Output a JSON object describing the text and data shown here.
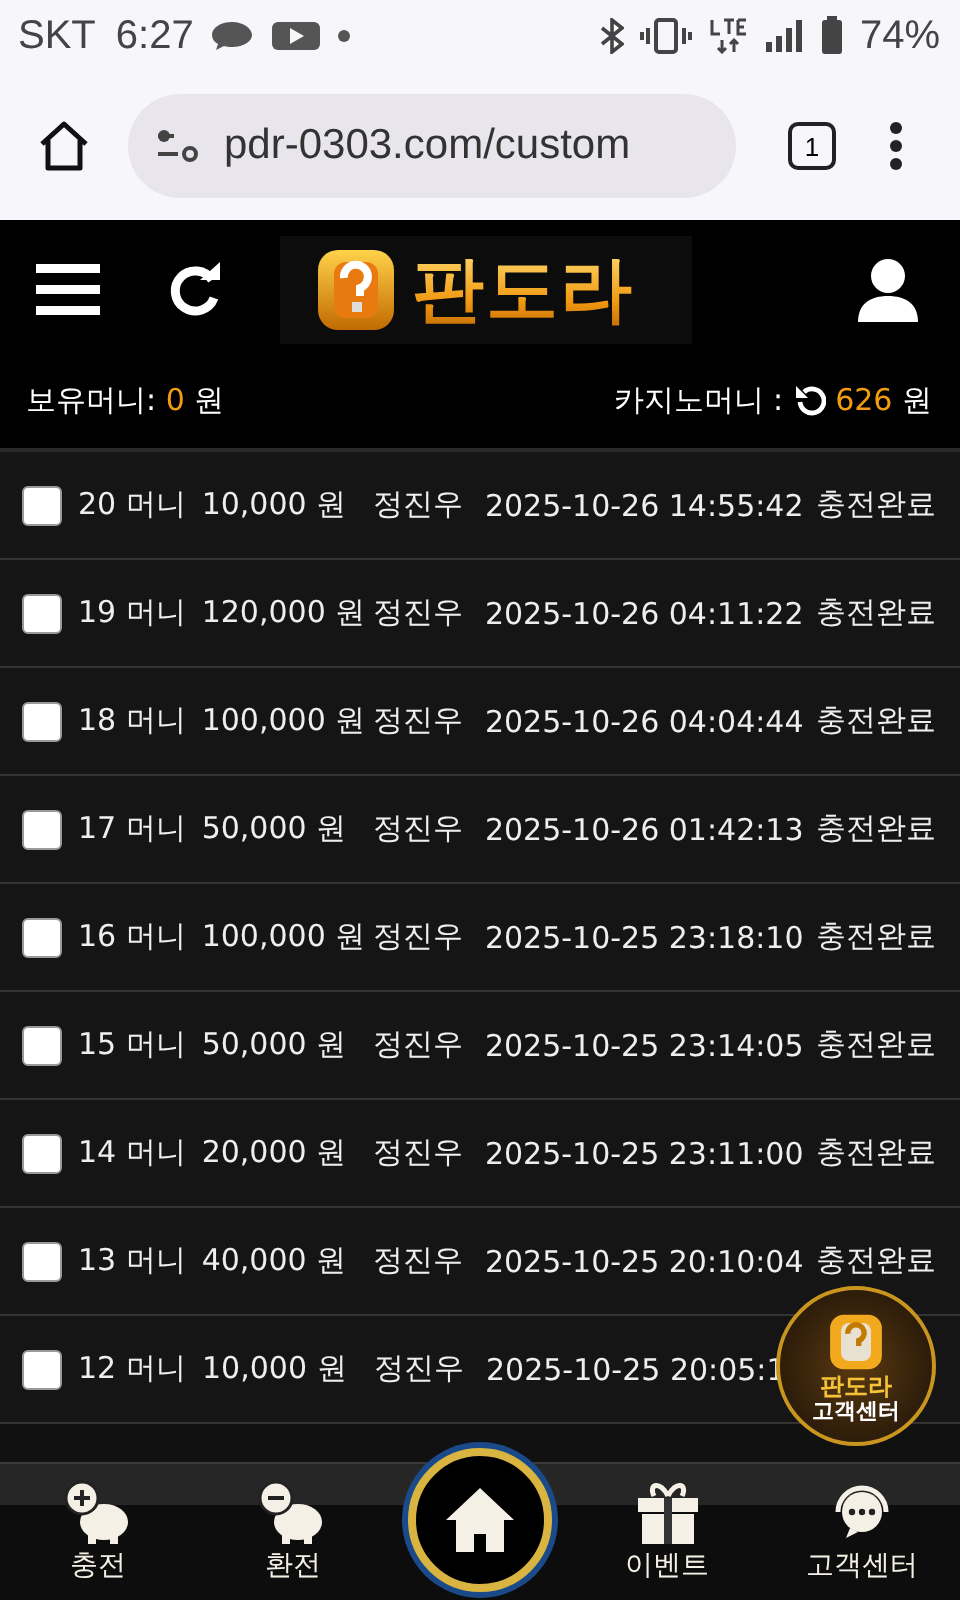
{
  "status_bar": {
    "carrier": "SKT",
    "time": "6:27",
    "battery": "74%"
  },
  "browser": {
    "url": "pdr-0303.com/custom",
    "tab_count": "1"
  },
  "header": {
    "logo": "판도라"
  },
  "balance": {
    "label": "보유머니:",
    "amount": "0",
    "unit": "원"
  },
  "casino": {
    "label": "카지노머니 :",
    "amount": "626",
    "unit": "원"
  },
  "rows": [
    {
      "checked": false,
      "number": "20 머니",
      "amount": "10,000 원",
      "name": "정진우",
      "date": "2025-10-26 14:55:42",
      "status": "충전완료"
    },
    {
      "checked": false,
      "number": "19 머니",
      "amount": "120,000 원",
      "name": "정진우",
      "date": "2025-10-26 04:11:22",
      "status": "충전완료"
    },
    {
      "checked": false,
      "number": "18 머니",
      "amount": "100,000 원",
      "name": "정진우",
      "date": "2025-10-26 04:04:44",
      "status": "충전완료"
    },
    {
      "checked": false,
      "number": "17 머니",
      "amount": "50,000 원",
      "name": "정진우",
      "date": "2025-10-26 01:42:13",
      "status": "충전완료"
    },
    {
      "checked": false,
      "number": "16 머니",
      "amount": "100,000 원",
      "name": "정진우",
      "date": "2025-10-25 23:18:10",
      "status": "충전완료"
    },
    {
      "checked": false,
      "number": "15 머니",
      "amount": "50,000 원",
      "name": "정진우",
      "date": "2025-10-25 23:14:05",
      "status": "충전완료"
    },
    {
      "checked": false,
      "number": "14 머니",
      "amount": "20,000 원",
      "name": "정진우",
      "date": "2025-10-25 23:11:00",
      "status": "충전완료"
    },
    {
      "checked": false,
      "number": "13 머니",
      "amount": "40,000 원",
      "name": "정진우",
      "date": "2025-10-25 20:10:04",
      "status": "충전완료"
    },
    {
      "checked": false,
      "number": "12 머니",
      "amount": "10,000 원",
      "name": "정진우",
      "date": "2025-10-25 20:05:1"
    }
  ],
  "support_badge": {
    "title": "판도라",
    "subtitle": "고객센터"
  },
  "bottom_nav": [
    {
      "kind": "deposit",
      "label": "충전"
    },
    {
      "kind": "withdraw",
      "label": "환전"
    },
    {
      "kind": "home"
    },
    {
      "kind": "event",
      "label": "이벤트"
    },
    {
      "kind": "support",
      "label": "고객센터"
    }
  ]
}
